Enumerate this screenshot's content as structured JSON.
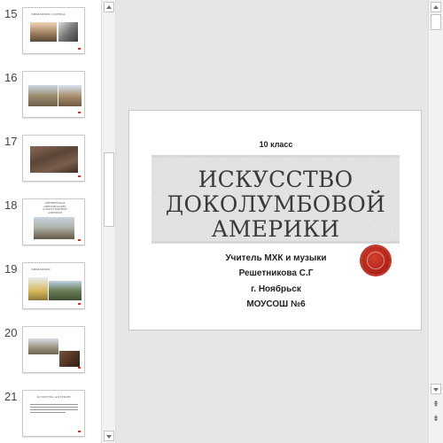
{
  "thumbnails": [
    {
      "number": "15",
      "title": "ПИРАМИДЫ СОЛНЦА"
    },
    {
      "number": "16",
      "title": ""
    },
    {
      "number": "17",
      "title": ""
    },
    {
      "number": "18",
      "title": "ДРЕВНЕЙШАЯ ЦИВИЛИЗАЦИЯ ДОКОЛУМБОВОЙ АМЕРИКИ"
    },
    {
      "number": "19",
      "title": "ПИРАМИДЫ"
    },
    {
      "number": "20",
      "title": ""
    },
    {
      "number": "21",
      "title": "КУЛЬТУРА АЦТЕКОВ"
    }
  ],
  "slide": {
    "grade": "10 класс",
    "title_lines": [
      "ИСКУССТВО",
      "ДОКОЛУМБОВОЙ",
      "АМЕРИКИ"
    ],
    "author_lines": [
      "Учитель МХК и музыки",
      "Решетникова С.Г",
      "г. Ноябрьск",
      "МОУСОШ №6"
    ]
  },
  "scrollbars": {
    "left_up_icon": "chevron-up-icon",
    "left_down_icon": "chevron-down-icon",
    "right_prev_icon": "double-chevron-up-icon",
    "right_next_icon": "double-chevron-down-icon"
  },
  "colors": {
    "accent_red": "#c0392b",
    "background": "#e6e6e6"
  }
}
